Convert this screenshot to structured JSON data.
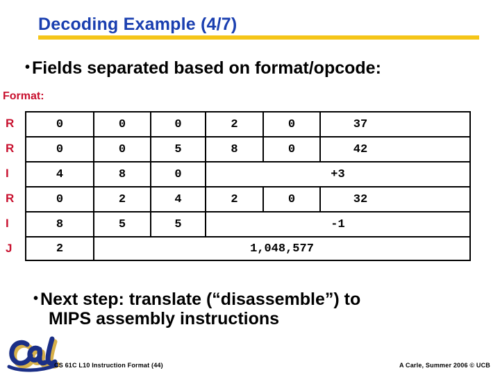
{
  "slide": {
    "title": "Decoding Example (4/7)",
    "title_color": "#1a3fb0",
    "rule_color": "#f5c518",
    "accent_red": "#c8102e",
    "bullet_glyph": "•"
  },
  "bullets": {
    "first": "Fields separated based on format/opcode:",
    "second_line1": "Next step: translate (“disassemble”) to",
    "second_line2": "MIPS assembly instructions"
  },
  "format_section": {
    "label": "Format:"
  },
  "table": {
    "rows": [
      {
        "format": "R",
        "cells": [
          "0",
          "0",
          "0",
          "2",
          "0",
          "37"
        ]
      },
      {
        "format": "R",
        "cells": [
          "0",
          "0",
          "5",
          "8",
          "0",
          "42"
        ]
      },
      {
        "format": "I",
        "cells": [
          "4",
          "8",
          "0",
          "+3"
        ]
      },
      {
        "format": "R",
        "cells": [
          "0",
          "2",
          "4",
          "2",
          "0",
          "32"
        ]
      },
      {
        "format": "I",
        "cells": [
          "8",
          "5",
          "5",
          "-1"
        ]
      },
      {
        "format": "J",
        "cells": [
          "2",
          "1,048,577"
        ]
      }
    ]
  },
  "footer": {
    "logo_alt": "cal-logo",
    "left": "CS 61C L10 Instruction Format (44)",
    "right": "A Carle, Summer 2006 © UCB"
  }
}
